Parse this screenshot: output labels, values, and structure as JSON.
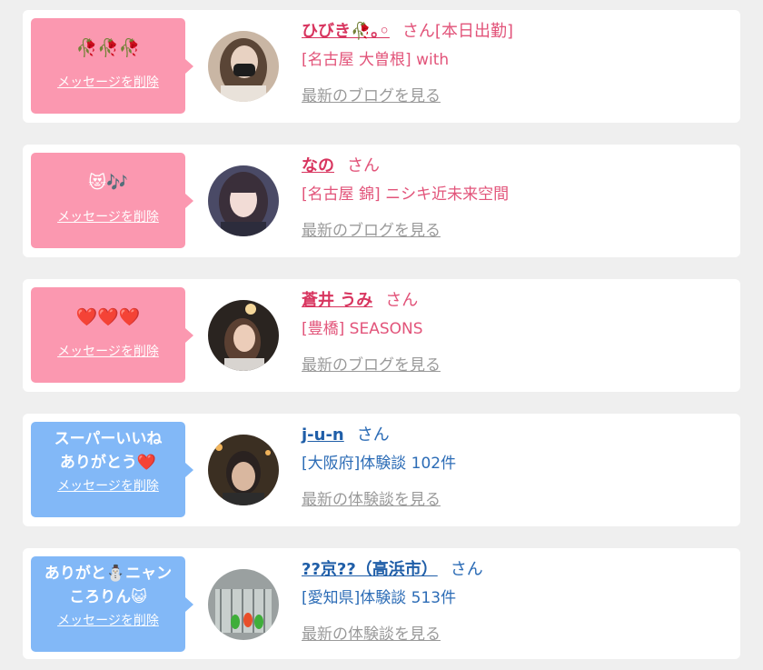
{
  "messages": [
    {
      "message": "🥀🥀🥀",
      "delete_label": "メッセージを削除",
      "name": "ひびき🥀｡◦",
      "honorific": "さん[本日出勤]",
      "location": "[名古屋 大曽根] with",
      "link": "最新のブログを見る",
      "theme": "pink"
    },
    {
      "message": "😻🎶",
      "delete_label": "メッセージを削除",
      "name": "なの",
      "honorific": "さん",
      "location": "[名古屋 錦] ニシキ近未来空間",
      "link": "最新のブログを見る",
      "theme": "pink"
    },
    {
      "message": "❤️❤️❤️",
      "delete_label": "メッセージを削除",
      "name": "蒼井 うみ",
      "honorific": "さん",
      "location": "[豊橋] SEASONS",
      "link": "最新のブログを見る",
      "theme": "pink"
    },
    {
      "message": "スーパーいいね\nありがとう❤️",
      "delete_label": "メッセージを削除",
      "name": "j-u-n",
      "honorific": "さん",
      "location": "[大阪府]体験談 102件",
      "link": "最新の体験談を見る",
      "theme": "blue"
    },
    {
      "message": "ありがと⛄️ニャン\nころりん😺",
      "delete_label": "メッセージを削除",
      "name": "??京??（高浜市）",
      "honorific": "さん",
      "location": "[愛知県]体験談 513件",
      "link": "最新の体験談を見る",
      "theme": "blue"
    }
  ],
  "colors": {
    "pink_bubble": "#fb98b0",
    "blue_bubble": "#82b8f7",
    "pink_text": "#e2547a",
    "blue_text": "#2c6cb6",
    "link_gray": "#9a9a9a",
    "background": "#efefef"
  }
}
